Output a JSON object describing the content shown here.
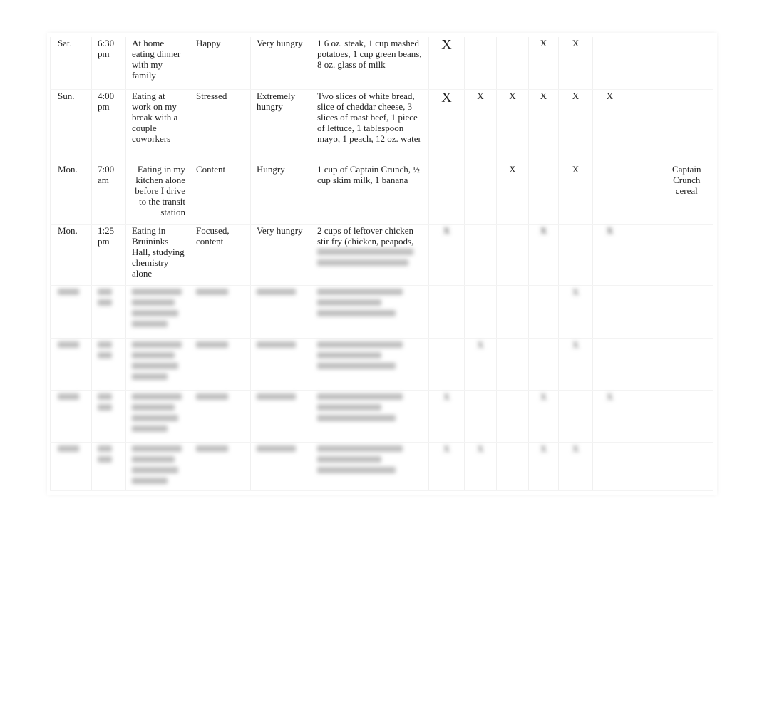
{
  "rows": [
    {
      "day": "Sat.",
      "time": "6:30 pm",
      "situation": "At home eating dinner with my family",
      "feeling": "Happy",
      "hunger": "Very hungry",
      "food": "1 6 oz. steak, 1 cup mashed potatoes, 1 cup green beans, 8 oz. glass of milk",
      "marks": [
        "X",
        "",
        "",
        "X",
        "X",
        "",
        "",
        ""
      ]
    },
    {
      "day": "Sun.",
      "time": "4:00 pm",
      "situation": "Eating at work on my break with a couple coworkers",
      "feeling": "Stressed",
      "hunger": "Extremely hungry",
      "food": "Two slices of white bread, slice of cheddar cheese, 3 slices of roast beef, 1 piece of lettuce, 1 tablespoon mayo, 1 peach, 12 oz. water",
      "marks": [
        "X",
        "X",
        "X",
        "X",
        "X",
        "X",
        "",
        ""
      ]
    },
    {
      "day": "Mon.",
      "time": "7:00 am",
      "situation": "Eating in my kitchen alone before I drive to the transit station",
      "feeling": "Content",
      "hunger": "Hungry",
      "food": "1 cup of Captain Crunch, ½ cup skim milk, 1 banana",
      "marks": [
        "",
        "",
        "X",
        "",
        "X",
        "",
        "",
        "Captain Crunch cereal"
      ]
    },
    {
      "day": "Mon.",
      "time": "1:25 pm",
      "situation": "Eating in Bruininks Hall, studying chemistry alone",
      "feeling": "Focused, content",
      "hunger": "Very hungry",
      "food": "2 cups of leftover chicken stir fry (chicken, peapods,",
      "marks": [
        "X",
        "",
        "",
        "X",
        "",
        "X",
        "",
        ""
      ]
    }
  ],
  "blurred_rows": [
    {
      "marks": [
        "",
        "",
        "",
        "",
        "X",
        "",
        "",
        ""
      ]
    },
    {
      "marks": [
        "",
        "X",
        "",
        "",
        "X",
        "",
        "",
        ""
      ]
    },
    {
      "marks": [
        "X",
        "",
        "",
        "X",
        "",
        "X",
        "",
        ""
      ]
    },
    {
      "marks": [
        "X",
        "X",
        "",
        "X",
        "X",
        "",
        "",
        ""
      ]
    }
  ]
}
